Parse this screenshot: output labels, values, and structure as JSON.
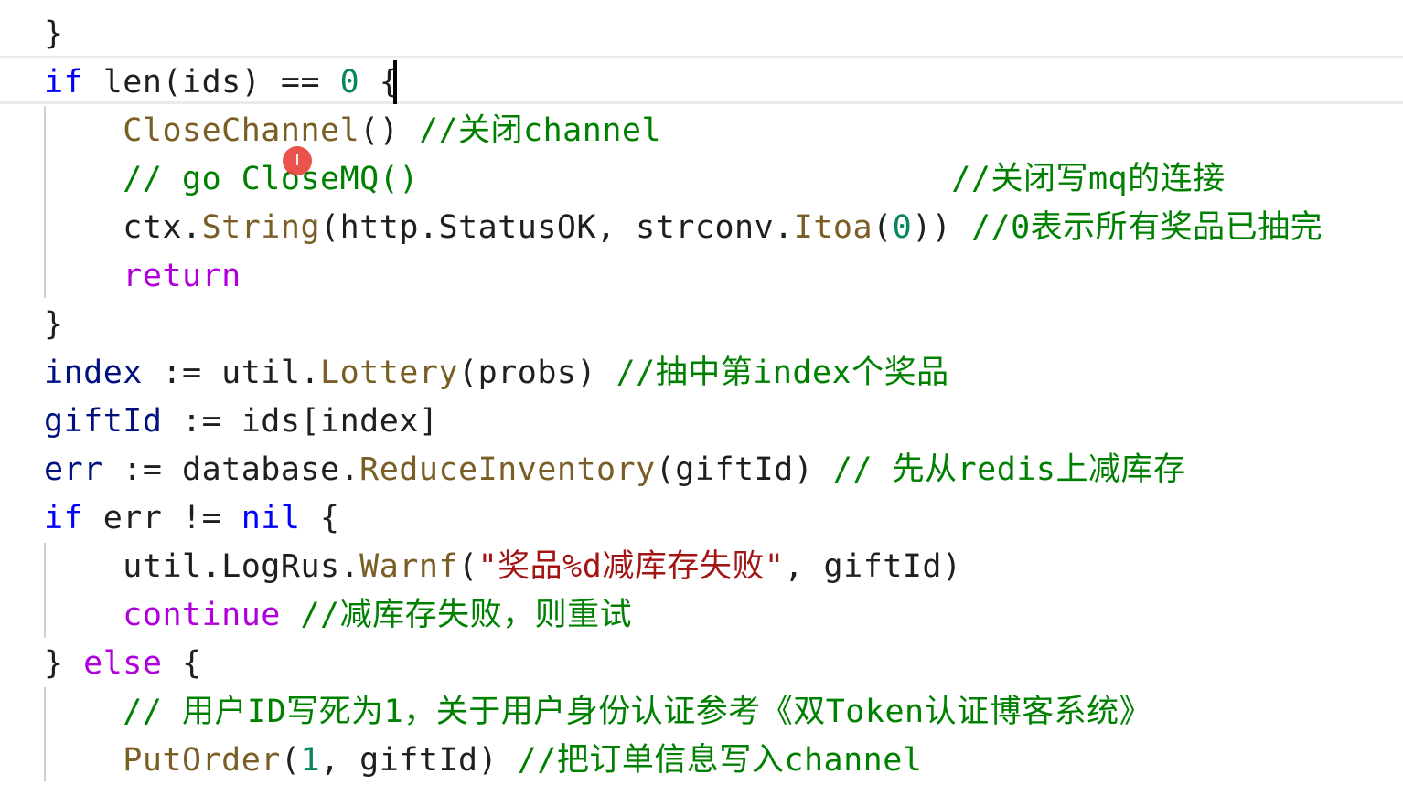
{
  "editor": {
    "lines": [
      {
        "tokens": [
          {
            "t": "}",
            "c": "plain"
          }
        ]
      },
      {
        "current": true,
        "tokens": [
          {
            "t": "if",
            "c": "kw"
          },
          {
            "t": " len(",
            "c": "plain"
          },
          {
            "t": "ids",
            "c": "plain"
          },
          {
            "t": ") == ",
            "c": "plain"
          },
          {
            "t": "0",
            "c": "num"
          },
          {
            "t": " {",
            "c": "plain"
          }
        ]
      },
      {
        "tokens": [
          {
            "t": "    ",
            "c": "plain"
          },
          {
            "t": "CloseChannel",
            "c": "fn"
          },
          {
            "t": "() ",
            "c": "plain"
          },
          {
            "t": "//关闭channel",
            "c": "cmt"
          }
        ]
      },
      {
        "tokens": [
          {
            "t": "    ",
            "c": "plain"
          },
          {
            "t": "// go CloseMQ()                           //关闭写mq的连接",
            "c": "cmt"
          }
        ]
      },
      {
        "tokens": [
          {
            "t": "    ",
            "c": "plain"
          },
          {
            "t": "ctx",
            "c": "plain"
          },
          {
            "t": ".",
            "c": "plain"
          },
          {
            "t": "String",
            "c": "fn"
          },
          {
            "t": "(http.StatusOK, strconv.",
            "c": "plain"
          },
          {
            "t": "Itoa",
            "c": "fn"
          },
          {
            "t": "(",
            "c": "plain"
          },
          {
            "t": "0",
            "c": "num"
          },
          {
            "t": ")) ",
            "c": "plain"
          },
          {
            "t": "//0表示所有奖品已抽完",
            "c": "cmt"
          }
        ]
      },
      {
        "tokens": [
          {
            "t": "    ",
            "c": "plain"
          },
          {
            "t": "return",
            "c": "kw2"
          }
        ]
      },
      {
        "tokens": [
          {
            "t": "}",
            "c": "plain"
          }
        ]
      },
      {
        "tokens": [
          {
            "t": "index",
            "c": "var"
          },
          {
            "t": " := util.",
            "c": "plain"
          },
          {
            "t": "Lottery",
            "c": "fn"
          },
          {
            "t": "(probs) ",
            "c": "plain"
          },
          {
            "t": "//抽中第index个奖品",
            "c": "cmt"
          }
        ]
      },
      {
        "tokens": [
          {
            "t": "giftId",
            "c": "var"
          },
          {
            "t": " := ids[index]",
            "c": "plain"
          }
        ]
      },
      {
        "tokens": [
          {
            "t": "err",
            "c": "var"
          },
          {
            "t": " := database.",
            "c": "plain"
          },
          {
            "t": "ReduceInventory",
            "c": "fn"
          },
          {
            "t": "(giftId) ",
            "c": "plain"
          },
          {
            "t": "// 先从redis上减库存",
            "c": "cmt"
          }
        ]
      },
      {
        "tokens": [
          {
            "t": "if",
            "c": "kw"
          },
          {
            "t": " err != ",
            "c": "plain"
          },
          {
            "t": "nil",
            "c": "kw"
          },
          {
            "t": " {",
            "c": "plain"
          }
        ]
      },
      {
        "tokens": [
          {
            "t": "    ",
            "c": "plain"
          },
          {
            "t": "util.LogRus.",
            "c": "plain"
          },
          {
            "t": "Warnf",
            "c": "fn"
          },
          {
            "t": "(",
            "c": "plain"
          },
          {
            "t": "\"奖品%d减库存失败\"",
            "c": "str"
          },
          {
            "t": ", giftId)",
            "c": "plain"
          }
        ]
      },
      {
        "tokens": [
          {
            "t": "    ",
            "c": "plain"
          },
          {
            "t": "continue",
            "c": "kw2"
          },
          {
            "t": " ",
            "c": "plain"
          },
          {
            "t": "//减库存失败，则重试",
            "c": "cmt"
          }
        ]
      },
      {
        "tokens": [
          {
            "t": "} ",
            "c": "plain"
          },
          {
            "t": "else",
            "c": "kw2"
          },
          {
            "t": " {",
            "c": "plain"
          }
        ]
      },
      {
        "tokens": [
          {
            "t": "    ",
            "c": "plain"
          },
          {
            "t": "// 用户ID写死为1，关于用户身份认证参考《双Token认证博客系统》",
            "c": "cmt"
          }
        ]
      },
      {
        "tokens": [
          {
            "t": "    ",
            "c": "plain"
          },
          {
            "t": "PutOrder",
            "c": "fn"
          },
          {
            "t": "(",
            "c": "plain"
          },
          {
            "t": "1",
            "c": "num"
          },
          {
            "t": ", giftId) ",
            "c": "plain"
          },
          {
            "t": "//把订单信息写入channel",
            "c": "cmt"
          }
        ]
      }
    ]
  },
  "cursor_marker": {
    "glyph": "I",
    "icon": "text-cursor-icon"
  }
}
